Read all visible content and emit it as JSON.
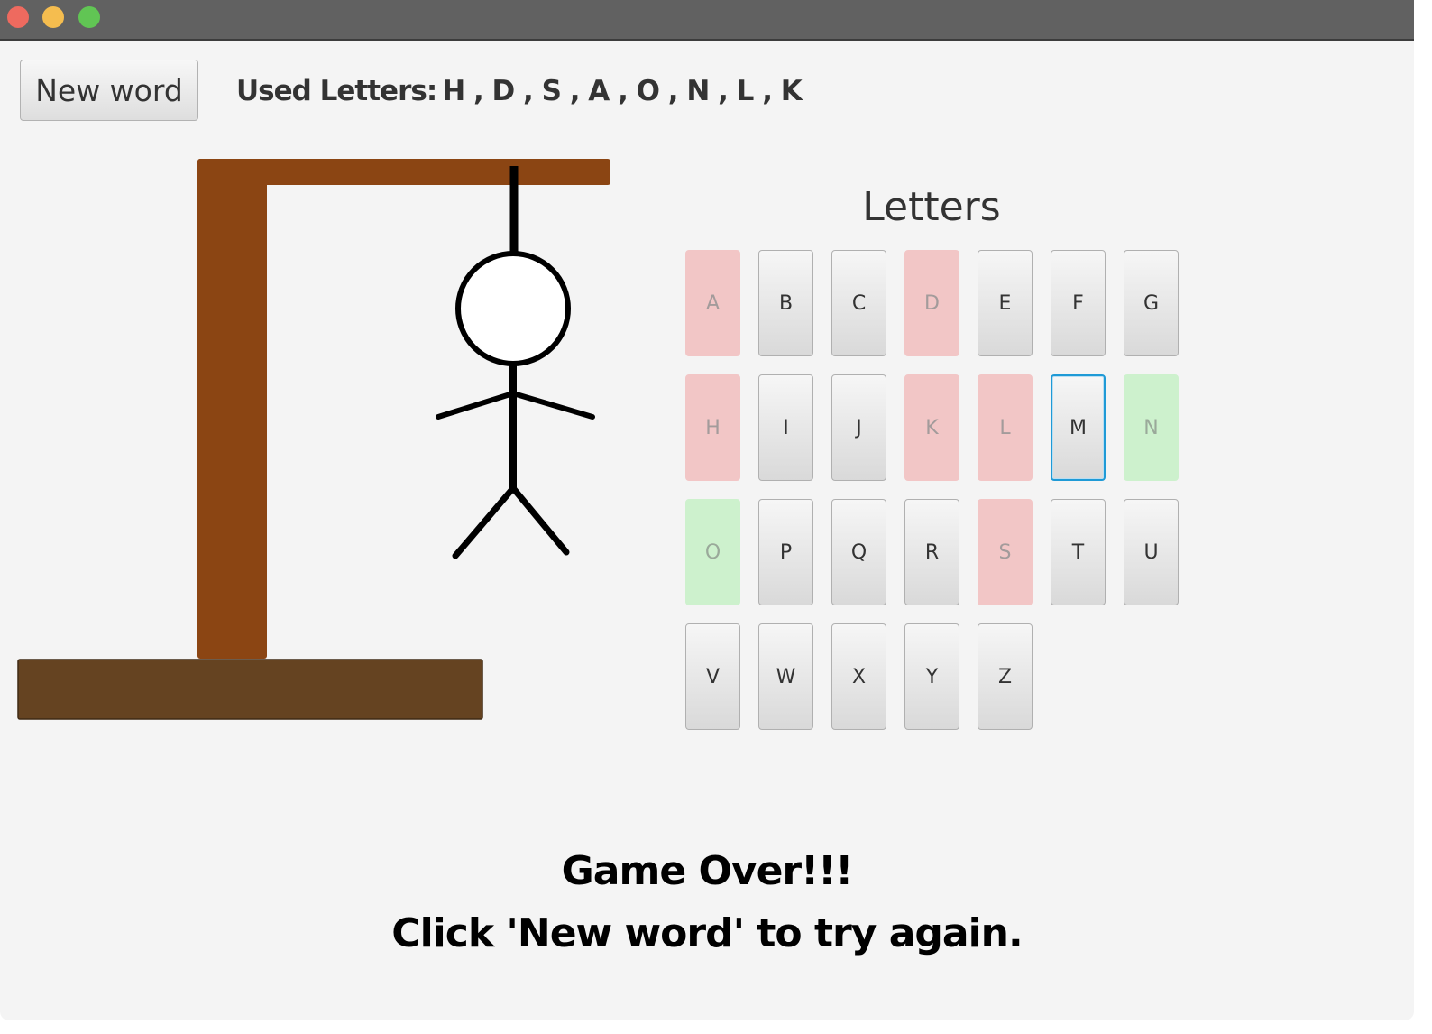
{
  "window": {
    "controls": [
      "close",
      "minimize",
      "maximize"
    ]
  },
  "toolbar": {
    "new_word_label": "New word",
    "used_letters_label": "Used Letters:",
    "used_letters_value": "H , D , S , A , O , N , L , K"
  },
  "letters_panel": {
    "title": "Letters",
    "keys": [
      {
        "letter": "A",
        "state": "wrong"
      },
      {
        "letter": "B",
        "state": "unused"
      },
      {
        "letter": "C",
        "state": "unused"
      },
      {
        "letter": "D",
        "state": "wrong"
      },
      {
        "letter": "E",
        "state": "unused"
      },
      {
        "letter": "F",
        "state": "unused"
      },
      {
        "letter": "G",
        "state": "unused"
      },
      {
        "letter": "H",
        "state": "wrong"
      },
      {
        "letter": "I",
        "state": "unused"
      },
      {
        "letter": "J",
        "state": "unused"
      },
      {
        "letter": "K",
        "state": "wrong"
      },
      {
        "letter": "L",
        "state": "wrong"
      },
      {
        "letter": "M",
        "state": "focused"
      },
      {
        "letter": "N",
        "state": "right"
      },
      {
        "letter": "O",
        "state": "right"
      },
      {
        "letter": "P",
        "state": "unused"
      },
      {
        "letter": "Q",
        "state": "unused"
      },
      {
        "letter": "R",
        "state": "unused"
      },
      {
        "letter": "S",
        "state": "wrong"
      },
      {
        "letter": "T",
        "state": "unused"
      },
      {
        "letter": "U",
        "state": "unused"
      },
      {
        "letter": "V",
        "state": "unused"
      },
      {
        "letter": "W",
        "state": "unused"
      },
      {
        "letter": "X",
        "state": "unused"
      },
      {
        "letter": "Y",
        "state": "unused"
      },
      {
        "letter": "Z",
        "state": "unused"
      }
    ]
  },
  "status": {
    "line1": "Game Over!!!",
    "line2": "Click 'New word' to try again."
  },
  "colors": {
    "wrong_key": "#f2c6c6",
    "right_key": "#cdf1cd",
    "gallows_wood": "#8b4513",
    "gallows_base": "#654321",
    "focus_ring": "#1f9ad6"
  }
}
